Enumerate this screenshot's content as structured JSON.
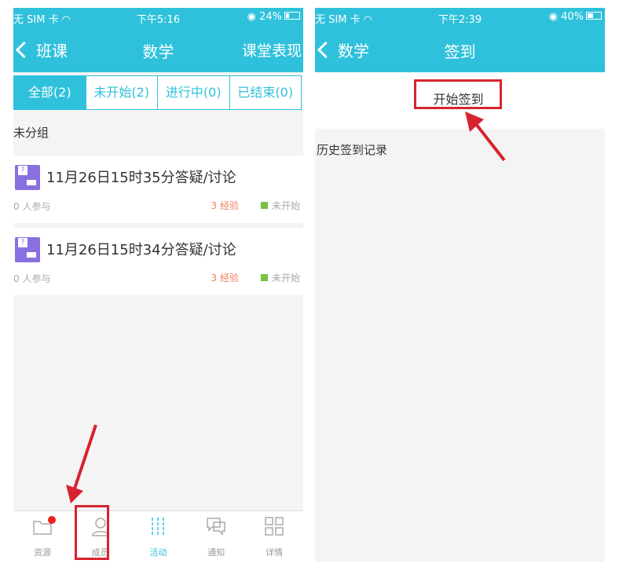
{
  "left_screen": {
    "status": {
      "carrier": "无 SIM 卡",
      "time": "下午5:16",
      "battery": "24%",
      "battery_fraction": 0.24
    },
    "nav": {
      "back_label": "班课",
      "title": "数学",
      "right_label": "课堂表现"
    },
    "tabs": [
      {
        "label": "全部(2)",
        "active": true
      },
      {
        "label": "未开始(2)",
        "active": false
      },
      {
        "label": "进行中(0)",
        "active": false
      },
      {
        "label": "已结束(0)",
        "active": false
      }
    ],
    "group_label": "未分组",
    "items": [
      {
        "title": "11月26日15时35分答疑/讨论",
        "participants": "0 人参与",
        "exp": "3 经验",
        "status": "未开始"
      },
      {
        "title": "11月26日15时34分答疑/讨论",
        "participants": "0 人参与",
        "exp": "3 经验",
        "status": "未开始"
      }
    ],
    "tabbar": [
      {
        "label": "资源",
        "icon": "folder-icon",
        "badge": true
      },
      {
        "label": "成员",
        "icon": "person-icon",
        "badge": false
      },
      {
        "label": "活动",
        "icon": "activity-icon",
        "active": true
      },
      {
        "label": "通知",
        "icon": "chat-icon"
      },
      {
        "label": "详情",
        "icon": "grid-icon"
      }
    ]
  },
  "right_screen": {
    "status": {
      "carrier": "无 SIM 卡",
      "time": "下午2:39",
      "battery": "40%",
      "battery_fraction": 0.4
    },
    "nav": {
      "back_label": "数学",
      "title": "签到"
    },
    "checkin_button": "开始签到",
    "history_label": "历史签到记录"
  },
  "colors": {
    "accent": "#2fc1db",
    "highlight": "#d7232f",
    "badge": "#8a6fe0",
    "status_dot": "#7ac143"
  }
}
